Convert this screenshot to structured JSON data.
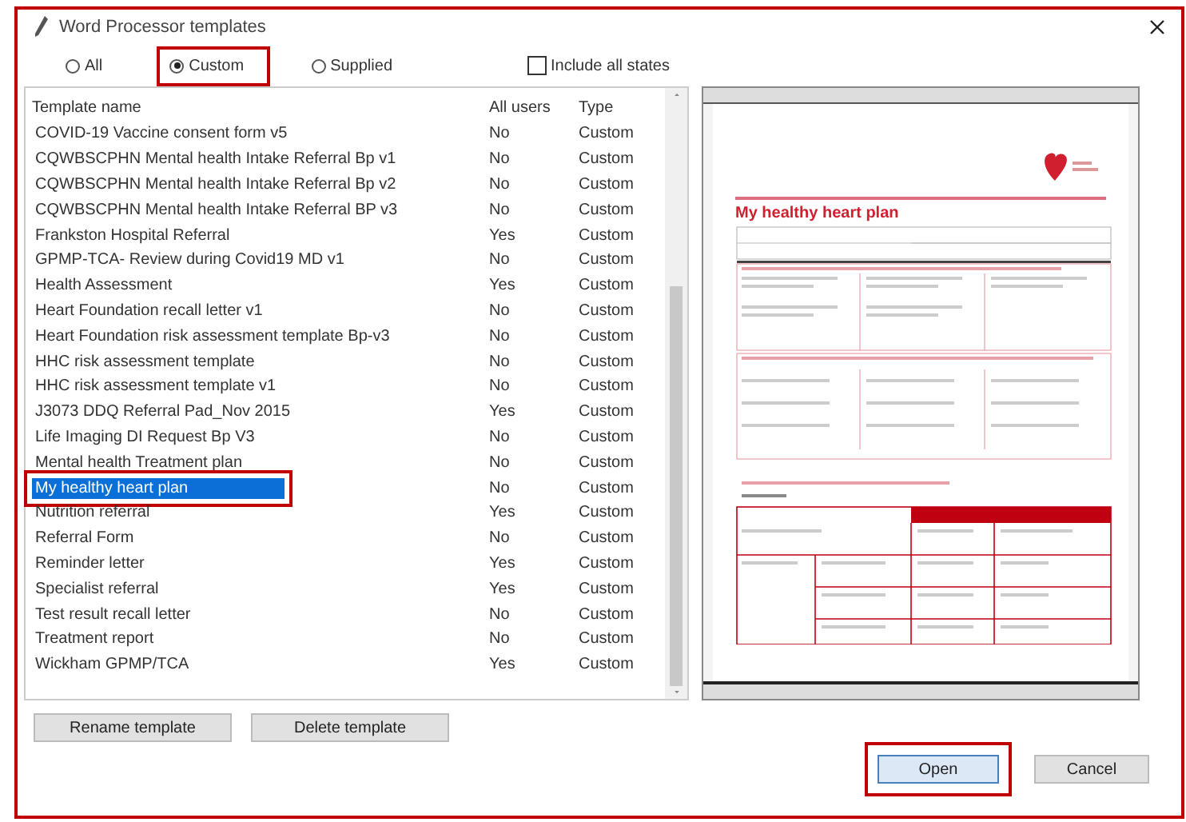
{
  "window": {
    "title": "Word Processor templates",
    "highlighted": true
  },
  "filters": [
    {
      "label": "All",
      "selected": false,
      "highlighted": false
    },
    {
      "label": "Custom",
      "selected": true,
      "highlighted": true
    },
    {
      "label": "Supplied",
      "selected": false,
      "highlighted": false
    }
  ],
  "include_all_states": {
    "label": "Include all states",
    "checked": false
  },
  "table": {
    "columns": [
      "Template name",
      "All users",
      "Type"
    ],
    "rows": [
      {
        "name": "COVID-19 Vaccine consent form v5",
        "all_users": "No",
        "type": "Custom",
        "selected": false,
        "highlighted": false
      },
      {
        "name": "CQWBSCPHN Mental health Intake Referral Bp v1",
        "all_users": "No",
        "type": "Custom",
        "selected": false,
        "highlighted": false
      },
      {
        "name": "CQWBSCPHN Mental health Intake Referral Bp v2",
        "all_users": "No",
        "type": "Custom",
        "selected": false,
        "highlighted": false
      },
      {
        "name": "CQWBSCPHN Mental health Intake Referral BP v3",
        "all_users": "No",
        "type": "Custom",
        "selected": false,
        "highlighted": false
      },
      {
        "name": "Frankston Hospital Referral",
        "all_users": "Yes",
        "type": "Custom",
        "selected": false,
        "highlighted": false
      },
      {
        "name": "GPMP-TCA- Review during Covid19 MD v1",
        "all_users": "No",
        "type": "Custom",
        "selected": false,
        "highlighted": false
      },
      {
        "name": "Health Assessment",
        "all_users": "Yes",
        "type": "Custom",
        "selected": false,
        "highlighted": false
      },
      {
        "name": "Heart Foundation recall letter v1",
        "all_users": "No",
        "type": "Custom",
        "selected": false,
        "highlighted": false
      },
      {
        "name": "Heart Foundation risk assessment template Bp-v3",
        "all_users": "No",
        "type": "Custom",
        "selected": false,
        "highlighted": false
      },
      {
        "name": "HHC risk assessment template",
        "all_users": "No",
        "type": "Custom",
        "selected": false,
        "highlighted": false
      },
      {
        "name": "HHC risk assessment template v1",
        "all_users": "No",
        "type": "Custom",
        "selected": false,
        "highlighted": false
      },
      {
        "name": "J3073 DDQ Referral Pad_Nov 2015",
        "all_users": "Yes",
        "type": "Custom",
        "selected": false,
        "highlighted": false
      },
      {
        "name": "Life Imaging DI Request Bp V3",
        "all_users": "No",
        "type": "Custom",
        "selected": false,
        "highlighted": false
      },
      {
        "name": "Mental health Treatment plan",
        "all_users": "No",
        "type": "Custom",
        "selected": false,
        "highlighted": false
      },
      {
        "name": "My healthy heart plan",
        "all_users": "No",
        "type": "Custom",
        "selected": true,
        "highlighted": true
      },
      {
        "name": "Nutrition referral",
        "all_users": "Yes",
        "type": "Custom",
        "selected": false,
        "highlighted": false
      },
      {
        "name": "Referral Form",
        "all_users": "No",
        "type": "Custom",
        "selected": false,
        "highlighted": false
      },
      {
        "name": "Reminder letter",
        "all_users": "Yes",
        "type": "Custom",
        "selected": false,
        "highlighted": false
      },
      {
        "name": "Specialist referral",
        "all_users": "Yes",
        "type": "Custom",
        "selected": false,
        "highlighted": false
      },
      {
        "name": "Test result recall letter",
        "all_users": "No",
        "type": "Custom",
        "selected": false,
        "highlighted": false
      },
      {
        "name": "Treatment report",
        "all_users": "No",
        "type": "Custom",
        "selected": false,
        "highlighted": false
      },
      {
        "name": "Wickham GPMP/TCA",
        "all_users": "Yes",
        "type": "Custom",
        "selected": false,
        "highlighted": false
      }
    ]
  },
  "preview": {
    "title": "My healthy heart plan"
  },
  "list_buttons": [
    {
      "label": "Rename template"
    },
    {
      "label": "Delete template"
    }
  ],
  "dialog_buttons": [
    {
      "label": "Open",
      "default": true,
      "highlighted": true
    },
    {
      "label": "Cancel",
      "default": false,
      "highlighted": false
    }
  ]
}
